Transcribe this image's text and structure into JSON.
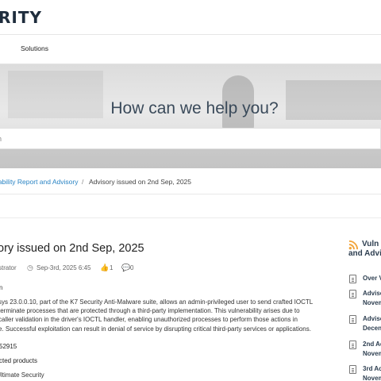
{
  "header": {
    "logo_text": "RITY"
  },
  "nav": {
    "items": [
      "s",
      "Solutions"
    ]
  },
  "hero": {
    "title": "How can we help you?",
    "search_placeholder": "h"
  },
  "breadcrumb": {
    "parent": "rability Report and Advisory",
    "separator": "/",
    "current": "Advisory issued on 2nd Sep, 2025"
  },
  "article": {
    "title": "ory issued on 2nd Sep, 2025",
    "author": "strator",
    "date": "Sep-3rd, 2025 6:45",
    "likes": "1",
    "comments": "0",
    "field_label": "n",
    "body_lines": [
      "sys 23.0.0.10, part of the K7 Security Anti-Malware suite, allows an admin-privileged user to send crafted IOCTL",
      "terminate processes that are protected through a third-party implementation. This vulnerability arises due to",
      "caller validation in the driver's IOCTL handler, enabling unauthorized processes to perform those actions in",
      "e. Successful exploitation can result in denial of service by disrupting critical third-party services or applications."
    ],
    "cve": "52915",
    "affected_label": "cted products",
    "product": "Jltimate Security"
  },
  "sidebar": {
    "title_line1": "Vuln",
    "title_line2": "and Advi",
    "items": [
      {
        "line1": "Over V",
        "line2": ""
      },
      {
        "line1": "Adviso",
        "line2": "Novem"
      },
      {
        "line1": "Adviso",
        "line2": "Decen"
      },
      {
        "line1": "2nd Ac",
        "line2": "Novem"
      },
      {
        "line1": "3rd Ac",
        "line2": "Novem"
      }
    ]
  },
  "colors": {
    "link": "#2a84c4",
    "rss": "#f2a43a",
    "heading": "#2d3e50"
  }
}
